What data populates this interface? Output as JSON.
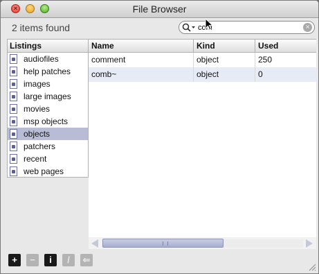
{
  "window": {
    "title": "File Browser"
  },
  "toolbar": {
    "found_text": "2 items found",
    "search_value": "com",
    "search_placeholder": ""
  },
  "listings": {
    "header": "Listings",
    "items": [
      {
        "label": "audiofiles",
        "selected": false
      },
      {
        "label": "help patches",
        "selected": false
      },
      {
        "label": "images",
        "selected": false
      },
      {
        "label": "large images",
        "selected": false
      },
      {
        "label": "movies",
        "selected": false
      },
      {
        "label": "msp objects",
        "selected": false
      },
      {
        "label": "objects",
        "selected": true
      },
      {
        "label": "patchers",
        "selected": false
      },
      {
        "label": "recent",
        "selected": false
      },
      {
        "label": "web pages",
        "selected": false
      }
    ]
  },
  "table": {
    "columns": [
      "Name",
      "Kind",
      "Used"
    ],
    "rows": [
      {
        "name": "comment",
        "kind": "object",
        "used": "250"
      },
      {
        "name": "comb~",
        "kind": "object",
        "used": "0"
      }
    ]
  },
  "bottombar": {
    "buttons": [
      {
        "icon": "plus-icon",
        "glyph": "+",
        "enabled": true
      },
      {
        "icon": "minus-icon",
        "glyph": "−",
        "enabled": false
      },
      {
        "icon": "info-icon",
        "glyph": "i",
        "enabled": true
      },
      {
        "icon": "edit-icon",
        "glyph": "/",
        "enabled": false
      },
      {
        "icon": "back-arrow-icon",
        "glyph": "⇐",
        "enabled": false
      }
    ]
  },
  "colors": {
    "selection": "#b8bcd4",
    "alt_row": "#e7ebf5",
    "scroll_thumb": "#a8aed0"
  }
}
